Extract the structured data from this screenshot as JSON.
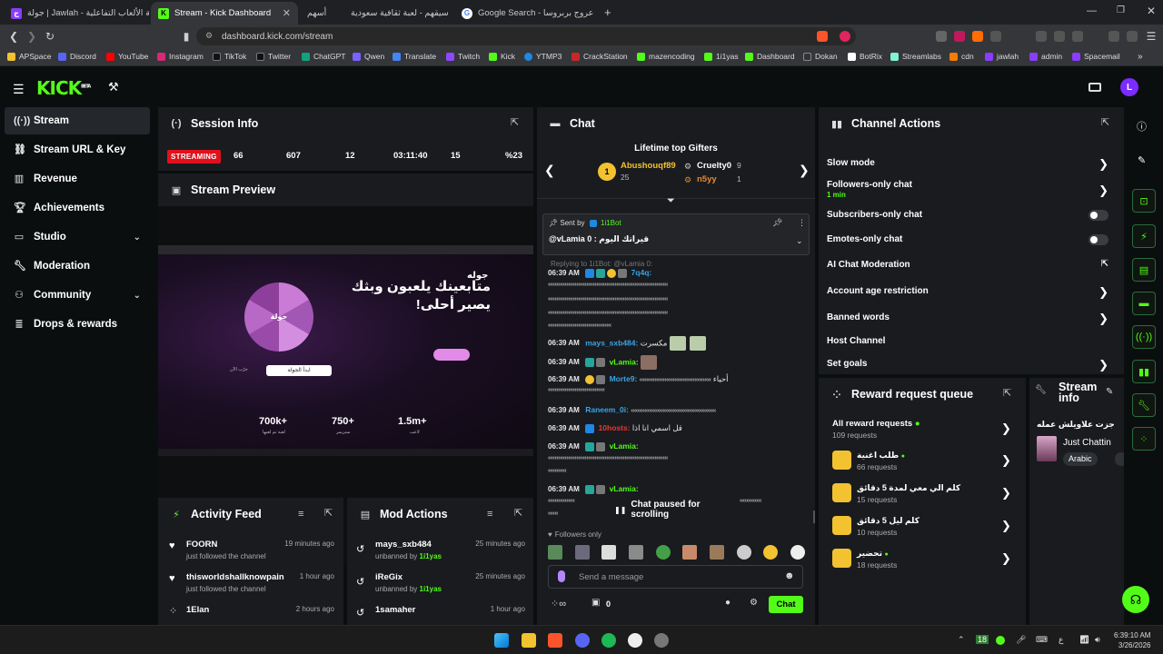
{
  "browser": {
    "tabs": [
      {
        "label": "جولة | Jawlah - منصة الألعاب التفاعلية"
      },
      {
        "label": "Stream - Kick Dashboard"
      },
      {
        "label": "أسهم"
      },
      {
        "label": "اسيقهم - لعبة ثقافية سعودية"
      },
      {
        "label": "Google Search - عروج بربروسا"
      }
    ],
    "url": "dashboard.kick.com/stream",
    "bookmarks": [
      "APSpace",
      "Discord",
      "YouTube",
      "Instagram",
      "TikTok",
      "Twitter",
      "ChatGPT",
      "Qwen",
      "Translate",
      "Twitch",
      "Kick",
      "YTMP3",
      "CrackStation",
      "mazencoding",
      "1i1yas",
      "Dashboard",
      "Dokan",
      "BotRix",
      "Streamlabs",
      "cdn",
      "jawlah",
      "admin",
      "Spacemail"
    ]
  },
  "app": {
    "logo": "KICK",
    "logo_sup": "BETA",
    "avatar_letter": "L",
    "accent": "#53fc18"
  },
  "sidebar": {
    "items": [
      {
        "label": "Stream",
        "icon": "broadcast-icon"
      },
      {
        "label": "Stream URL & Key",
        "icon": "link-icon"
      },
      {
        "label": "Revenue",
        "icon": "chart-icon"
      },
      {
        "label": "Achievements",
        "icon": "trophy-icon"
      },
      {
        "label": "Studio",
        "icon": "monitor-icon"
      },
      {
        "label": "Moderation",
        "icon": "wrench-icon"
      },
      {
        "label": "Community",
        "icon": "users-icon"
      },
      {
        "label": "Drops & rewards",
        "icon": "gift-icon"
      }
    ]
  },
  "session": {
    "title": "Session Info",
    "status": "STREAMING",
    "stats": [
      "66",
      "607",
      "12",
      "03:11:40",
      "15",
      "%23"
    ]
  },
  "preview": {
    "title": "Stream Preview",
    "heading": "متابعينك يلعبون وبثك يصير أحلى!",
    "brand": "جوله",
    "wheel_label": "جولة",
    "cta": "ابدأ الجولة",
    "secondary": "جرّب الآن",
    "stats": [
      {
        "value": "700k+",
        "label": "لعبة تم لعبها"
      },
      {
        "value": "750+",
        "label": "ستريمر"
      },
      {
        "value": "1.5m+",
        "label": "لاعب"
      }
    ]
  },
  "activity": {
    "title": "Activity Feed",
    "items": [
      {
        "name": "FOORN",
        "sub": "just followed the channel",
        "time": "19 minutes ago"
      },
      {
        "name": "thisworldshallknowpain",
        "sub": "just followed the channel",
        "time": "1 hour ago"
      },
      {
        "name": "1Elan",
        "sub": "",
        "time": "2 hours ago"
      }
    ]
  },
  "modactions": {
    "title": "Mod Actions",
    "items": [
      {
        "name": "mays_sxb484",
        "sub_prefix": "unbanned by ",
        "by": "1i1yas",
        "time": "25 minutes ago"
      },
      {
        "name": "iReGix",
        "sub_prefix": "unbanned by ",
        "by": "1i1yas",
        "time": "25 minutes ago"
      },
      {
        "name": "1samaher",
        "sub_prefix": "",
        "by": "",
        "time": "1 hour ago"
      }
    ]
  },
  "chat": {
    "title": "Chat",
    "gifters_title": "Lifetime top Gifters",
    "gifters": [
      {
        "name": "Abushouqf89",
        "count": "25",
        "rank": "1"
      },
      {
        "name": "Cruelty0",
        "count": "9"
      },
      {
        "name": "n5yy",
        "count": "1"
      }
    ],
    "pinned_by_label": "Sent by",
    "pinned_by": "1i1Bot",
    "pinned_msg": "@vLamia 0 : قيراتك اليوم",
    "replying": "Replying to 1i1Bot: @vLamia 0:",
    "messages": [
      {
        "time": "06:39 AM",
        "user": "7q4q:",
        "text": ""
      },
      {
        "time": "06:39 AM",
        "user": "mays_sxb484:",
        "text": "مكسرت"
      },
      {
        "time": "06:39 AM",
        "user": "vLamia:",
        "text": ""
      },
      {
        "time": "06:39 AM",
        "user": "Morte9:",
        "text": "أحياء"
      },
      {
        "time": "06:39 AM",
        "user": "Raneem_0i:",
        "text": ""
      },
      {
        "time": "06:39 AM",
        "user": "10hosts:",
        "text": "قل اسمي انا اذا"
      },
      {
        "time": "06:39 AM",
        "user": "vLamia:",
        "text": ""
      },
      {
        "time": "06:39 AM",
        "user": "vLamia:",
        "text": ""
      }
    ],
    "paused": "Chat paused for scrolling",
    "followers_only": "Followers only",
    "input_placeholder": "Send a message",
    "points": "0",
    "send_label": "Chat"
  },
  "channel_actions": {
    "title": "Channel Actions",
    "items": [
      {
        "label": "Slow mode",
        "sub": "",
        "control": "arrow"
      },
      {
        "label": "Followers-only chat",
        "sub": "1 min",
        "control": "arrow"
      },
      {
        "label": "Subscribers-only chat",
        "sub": "",
        "control": "toggle"
      },
      {
        "label": "Emotes-only chat",
        "sub": "",
        "control": "toggle"
      },
      {
        "label": "AI Chat Moderation",
        "sub": "",
        "control": "external"
      },
      {
        "label": "Account age restriction",
        "sub": "",
        "control": "arrow"
      },
      {
        "label": "Banned words",
        "sub": "",
        "control": "arrow"
      },
      {
        "label": "Host Channel",
        "sub": "",
        "control": "none"
      },
      {
        "label": "Set goals",
        "sub": "",
        "control": "arrow"
      }
    ]
  },
  "rewards": {
    "title": "Reward request queue",
    "all_label": "All reward requests",
    "all_sub": "109 requests",
    "items": [
      {
        "label": "طلب اغنية",
        "sub": "66 requests"
      },
      {
        "label": "كلم الي معي لمدة 5 دقائق",
        "sub": "15 requests"
      },
      {
        "label": "كلم ليل 5 دقائق",
        "sub": "10 requests"
      },
      {
        "label": "تحضير",
        "sub": "18 requests"
      }
    ]
  },
  "stream_info": {
    "title_line1": "Stream",
    "title_line2": "info",
    "stream_title": "جزت علاويلش عمله",
    "category": "Just Chattin",
    "tag": "Arabic"
  },
  "taskbar": {
    "time": "6:39:10 AM",
    "date": "3/26/2026",
    "lang": "ع",
    "badge": "18"
  }
}
